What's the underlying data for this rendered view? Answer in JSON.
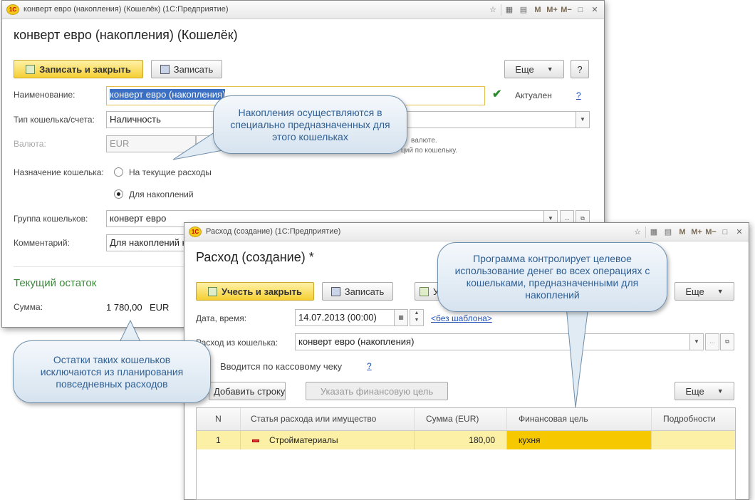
{
  "wallet": {
    "window_title": "конверт евро (накопления) (Кошелёк)   (1С:Предприятие)",
    "form_title": "конверт евро (накопления) (Кошелёк)",
    "save_close": "Записать и закрыть",
    "save": "Записать",
    "more": "Еще",
    "help": "?",
    "name_label": "Наименование:",
    "name_value": "конверт евро (накопления)",
    "active_label": "Актуален",
    "help_link": "?",
    "type_label": "Тип кошелька/счета:",
    "type_value": "Наличность",
    "currency_label": "Валюта:",
    "currency_value": "EUR",
    "currency_note1": "валюте.",
    "currency_note2": "ций по кошельку.",
    "purpose_label": "Назначение кошелька:",
    "purpose_opt1": "На текущие расходы",
    "purpose_opt2": "Для накоплений",
    "group_label": "Группа кошельков:",
    "group_value": "конверт евро",
    "comment_label": "Комментарий:",
    "comment_value": "Для накоплений н",
    "balance_title": "Текущий остаток",
    "sum_label": "Сумма:",
    "sum_value": "1 780,00",
    "sum_currency": "EUR"
  },
  "expense": {
    "window_title": "Расход (создание)   (1С:Предприятие)",
    "form_title": "Расход (создание) *",
    "post_close": "Учесть и закрыть",
    "save": "Записать",
    "partial_button": "У",
    "more": "Еще",
    "date_label": "Дата, время:",
    "date_value": "14.07.2013 (00:00)",
    "template_link": "<без шаблона>",
    "wallet_label": "Расход из кошелька:",
    "wallet_value": "конверт евро (накопления)",
    "receipt_label": "Вводится по кассовому чеку",
    "receipt_help": "?",
    "add_row": "Добавить строку",
    "set_goal": "Указать финансовую цель",
    "table_more": "Еще",
    "table": {
      "columns": [
        "N",
        "Статья расхода или имущество",
        "Сумма (EUR)",
        "Финансовая цель",
        "Подробности"
      ],
      "rows": [
        {
          "n": "1",
          "item": "Стройматериалы",
          "sum": "180,00",
          "goal": "кухня",
          "details": ""
        }
      ]
    }
  },
  "callouts": {
    "savings": "Накопления осуществляются в специально предназначенных для этого кошельках",
    "control": "Программа контролирует целевое использование денег во всех операциях с кошельками, предназначенными для накоплений",
    "excluded": "Остатки таких кошельков исключаются из планирования повседневных расходов"
  },
  "colors": {
    "accent_yellow": "#f5cf35",
    "callout_text": "#2f5f93",
    "link": "#1f4fb5",
    "selection": "#3a6fc4"
  }
}
